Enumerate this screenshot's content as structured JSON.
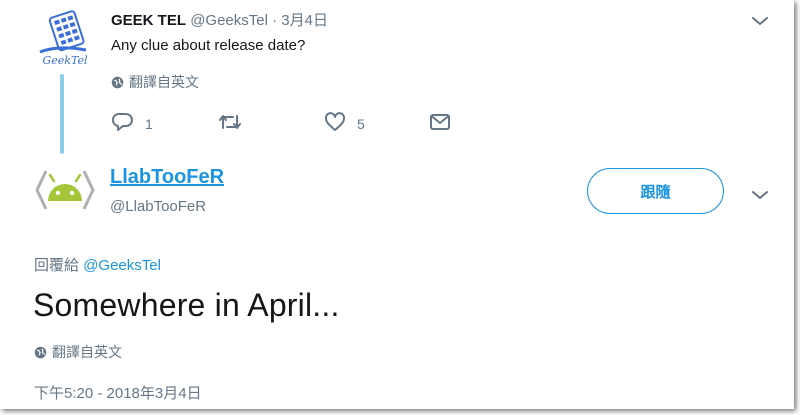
{
  "parent_tweet": {
    "display_name": "GEEK TEL",
    "handle": "@GeeksTel",
    "date": "· 3月4日",
    "text": "Any clue about release date?",
    "translate_label": "翻譯自英文",
    "reply_count": "1",
    "like_count": "5",
    "icons": [
      "reply-icon",
      "retweet-icon",
      "like-icon",
      "direct-message-icon",
      "chevron-down-icon",
      "globe-icon"
    ]
  },
  "main_tweet": {
    "display_name": "LlabTooFeR",
    "handle": "@LlabTooFeR",
    "follow_label": "跟隨",
    "reply_prefix": "回覆給",
    "reply_target": "@GeeksTel",
    "text": "Somewhere in April...",
    "translate_label": "翻譯自英文",
    "timestamp": "下午5:20 - 2018年3月4日"
  },
  "colors": {
    "link_blue": "#1b95e0",
    "muted_gray": "#657786",
    "thread_line": "#8ccfe6",
    "android_green": "#a4c639"
  }
}
